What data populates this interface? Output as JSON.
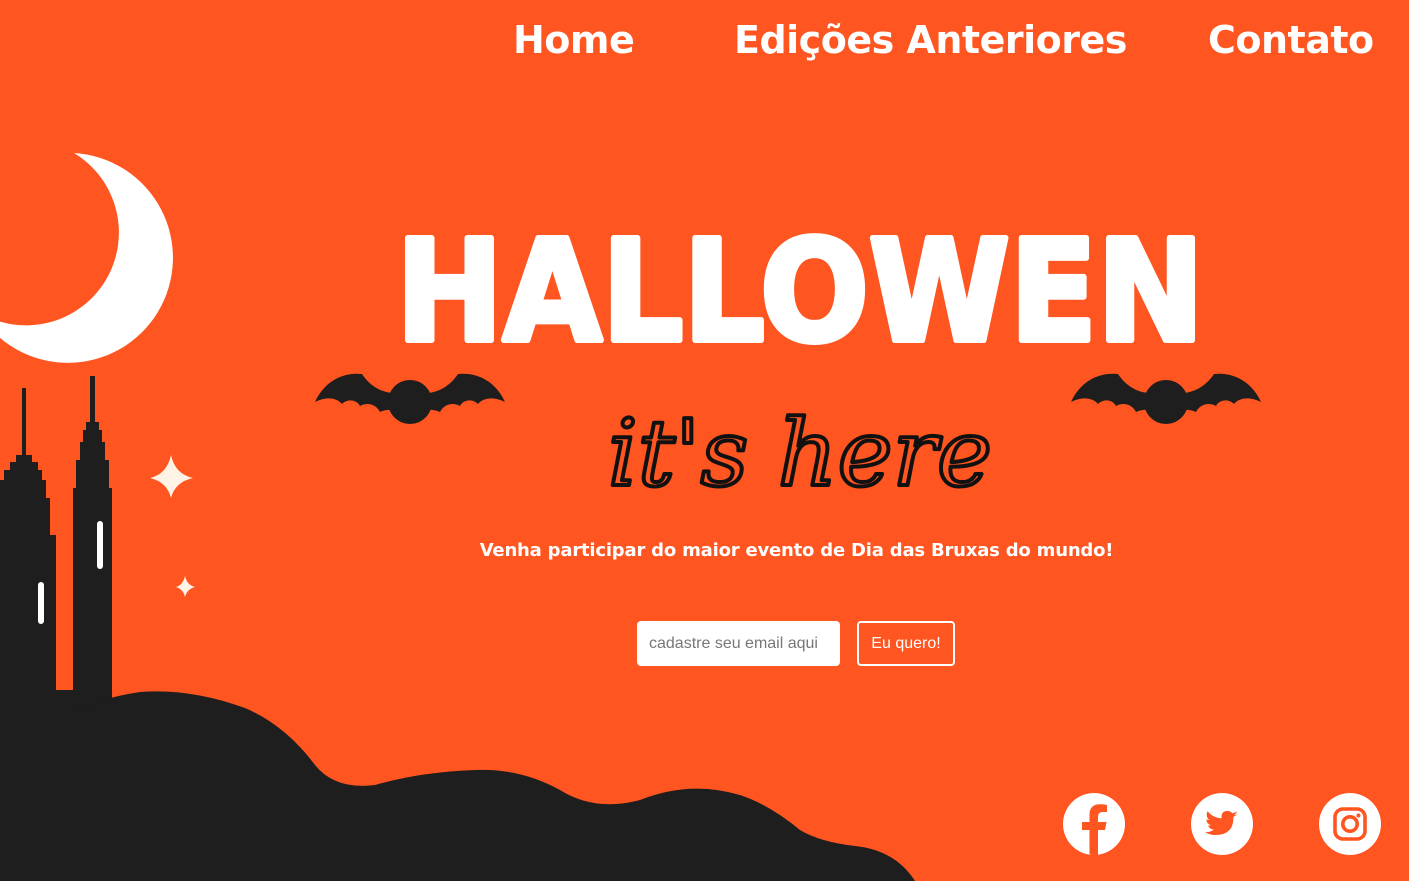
{
  "nav": {
    "home": "Home",
    "editions": "Edições Anteriores",
    "contact": "Contato"
  },
  "hero": {
    "title": "HALLOWEN",
    "subtitle": "it's here",
    "tagline": "Venha participar do maior evento de Dia das Bruxas do mundo!"
  },
  "signup": {
    "email_placeholder": "cadastre seu email aqui",
    "button_label": "Eu quero!"
  },
  "social": [
    "facebook-icon",
    "twitter-icon",
    "instagram-icon"
  ],
  "colors": {
    "background": "#FF5520",
    "silhouette": "#1E1E1E",
    "text": "#FFFFFF",
    "moon": "#FFFFFF",
    "sparkle": "#FFF3E6"
  }
}
